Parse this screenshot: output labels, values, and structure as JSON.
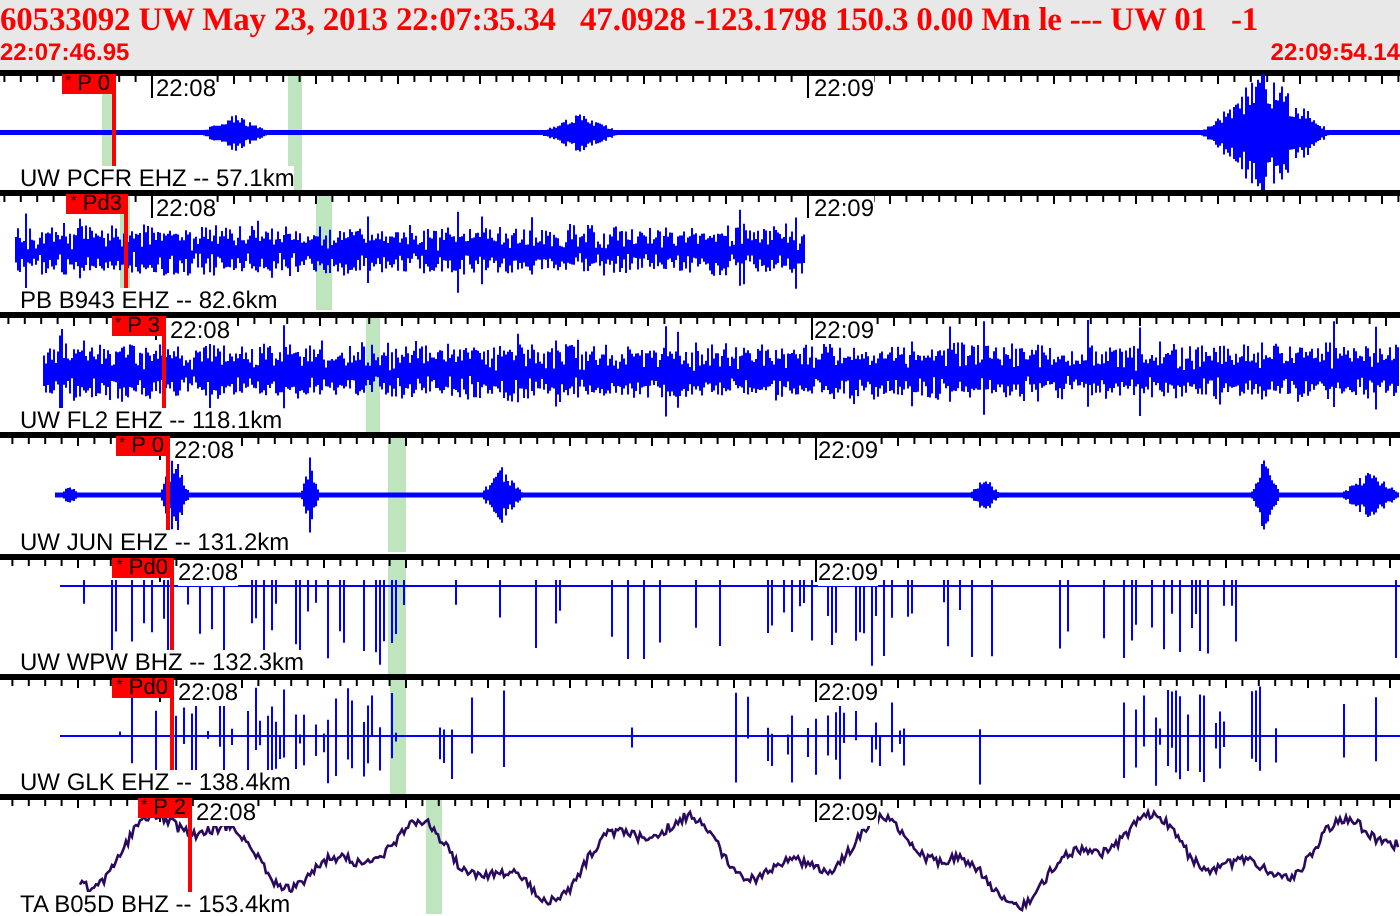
{
  "header": {
    "title": "60533092 UW May 23, 2013 22:07:35.34   47.0928 -123.1798 150.3 0.00 Mn le --- UW 01   -1",
    "start_time": "22:07:46.95",
    "end_time": "22:09:54.14"
  },
  "traces": [
    {
      "station": "UW PCFR EHZ -- 57.1km",
      "pick": "$^{*}$ P 0",
      "kind": "bursts",
      "color": "#0000ff",
      "time_marks": [
        "22:08",
        "22:09"
      ]
    },
    {
      "station": "PB B943 EHZ -- 82.6km",
      "pick": "$^{*}$ Pd3",
      "kind": "noise",
      "color": "#0000ff",
      "time_marks": [
        "22:08",
        "22:09"
      ]
    },
    {
      "station": "UW FL2 EHZ -- 118.1km",
      "pick": "$^{*}$ P 3",
      "kind": "noise",
      "color": "#0000ff",
      "time_marks": [
        "22:08",
        "22:09"
      ]
    },
    {
      "station": "UW JUN EHZ -- 131.2km",
      "pick": "$^{*}$ P 0",
      "kind": "bursts",
      "color": "#0000ff",
      "time_marks": [
        "22:08",
        "22:09"
      ]
    },
    {
      "station": "UW WPW BHZ -- 132.3km",
      "pick": "$^{*}$ Pd0",
      "kind": "spikes",
      "color": "#0000ff",
      "time_marks": [
        "22:08",
        "22:09"
      ]
    },
    {
      "station": "UW GLK EHZ -- 138.4km",
      "pick": "$^{*}$ Pd0",
      "kind": "spikes",
      "color": "#0000ff",
      "time_marks": [
        "22:08",
        "22:09"
      ]
    },
    {
      "station": "TA B05D BHZ -- 153.4km",
      "pick": "$^{*}$ P 2",
      "kind": "longperiod",
      "color": "#2a0a5e",
      "time_marks": [
        "22:08",
        "22:09"
      ]
    }
  ]
}
